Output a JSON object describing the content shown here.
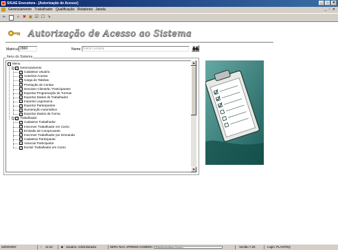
{
  "window": {
    "title": "SIGAE Executora - [Autorização de Acesso]",
    "controls": [
      "_",
      "▫",
      "✕"
    ]
  },
  "menubar": {
    "items": [
      "Gerenciamento",
      "Trabalhador",
      "Qualificação",
      "Relatórios",
      "Janela"
    ],
    "mdi_controls": "_ ▫ ✕"
  },
  "header": {
    "title": "Autorização de Acesso ao Sistema"
  },
  "form": {
    "matricula_label": "Matrícula",
    "matricula_value": "2960",
    "nome_label": "Nome",
    "nome_value": "Karla Luciana"
  },
  "group_label": "Itens do Sistema",
  "tree": [
    {
      "label": "Menu",
      "level": 0,
      "checked": false,
      "expander": ""
    },
    {
      "label": "Gerenciamento",
      "level": 1,
      "checked": true,
      "expander": "-"
    },
    {
      "label": "Cadastrar Usuário",
      "level": 2,
      "checked": true,
      "expander": ""
    },
    {
      "label": "Autorizar Acesso",
      "level": 2,
      "checked": true,
      "expander": ""
    },
    {
      "label": "Carga de Tabelas",
      "level": 2,
      "checked": true,
      "expander": ""
    },
    {
      "label": "Prestação de Contas",
      "level": 2,
      "checked": true,
      "expander": ""
    },
    {
      "label": "Devolver Clientela / Participantes",
      "level": 2,
      "checked": true,
      "expander": ""
    },
    {
      "label": "Exportar Programação de Turmas",
      "level": 2,
      "checked": true,
      "expander": ""
    },
    {
      "label": "Exportar Dados do Trabalhador",
      "level": 2,
      "checked": true,
      "expander": ""
    },
    {
      "label": "Importar Logomarca",
      "level": 2,
      "checked": true,
      "expander": ""
    },
    {
      "label": "Exportar Participantes",
      "level": 2,
      "checked": true,
      "expander": ""
    },
    {
      "label": "Numeração Automática",
      "level": 2,
      "checked": true,
      "expander": ""
    },
    {
      "label": "Exportar Dados da Turma",
      "level": 2,
      "checked": true,
      "expander": ""
    },
    {
      "label": "Trabalhador",
      "level": 1,
      "checked": true,
      "expander": "-"
    },
    {
      "label": "Cadastrar Trabalhador",
      "level": 2,
      "checked": true,
      "expander": ""
    },
    {
      "label": "Inscrever Trabalhador em Curso",
      "level": 2,
      "checked": true,
      "expander": ""
    },
    {
      "label": "Emissão de Comprovante",
      "level": 2,
      "checked": true,
      "expander": ""
    },
    {
      "label": "Inscrever Trabalhador por Demanda",
      "level": 2,
      "checked": true,
      "expander": ""
    },
    {
      "label": "Cadastrar Participante",
      "level": 2,
      "checked": true,
      "expander": ""
    },
    {
      "label": "Associar Participante",
      "level": 2,
      "checked": true,
      "expander": ""
    },
    {
      "label": "Excluir Trabalhador em Curso",
      "level": 2,
      "checked": true,
      "expander": ""
    }
  ],
  "statusbar": {
    "date": "26/02/2007",
    "time": "11:24",
    "user": "Usuário: Administrador",
    "unit": "SERV NAC APREND COMERCIAL SENA",
    "progress_text": "Trabalhador/Itens Acesso",
    "version": "Versão 7.20",
    "login": "Login: PLANTEQ"
  },
  "colors": {
    "titlebar": "#0a246a",
    "panel": "#d4d0c8",
    "picture_bg": "#2c7c78"
  }
}
